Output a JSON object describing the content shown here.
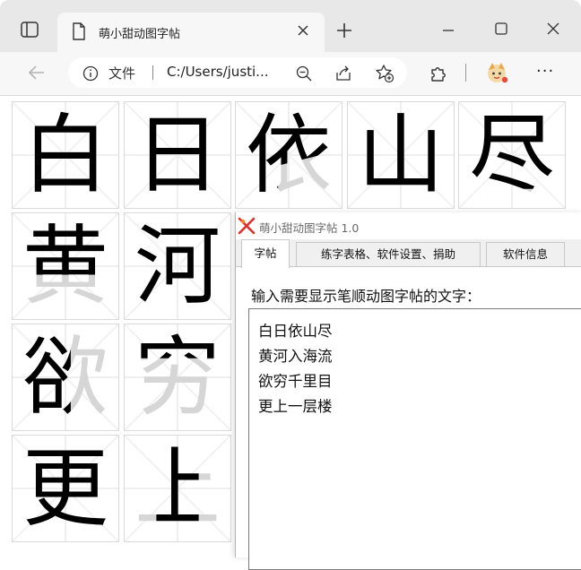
{
  "browser": {
    "tab_title": "萌小甜动图字帖",
    "address_file_label": "文件",
    "address_url": "C:/Users/justi...",
    "more_label": "···"
  },
  "grid": {
    "cells": [
      {
        "char": "白",
        "stage": "complete"
      },
      {
        "char": "日",
        "stage": "complete"
      },
      {
        "char": "依",
        "stage": "partial"
      },
      {
        "char": "山",
        "stage": "complete"
      },
      {
        "char": "尽",
        "stage": "partial"
      },
      {
        "char": "黄",
        "stage": "partial"
      },
      {
        "char": "河",
        "stage": "complete"
      },
      {
        "char": "欲",
        "stage": "partial"
      },
      {
        "char": "穷",
        "stage": "partial"
      },
      {
        "char": "更",
        "stage": "complete"
      },
      {
        "char": "上",
        "stage": "partial"
      }
    ]
  },
  "app": {
    "title": "萌小甜动图字帖 1.0",
    "tabs": [
      {
        "label": "字帖",
        "active": true
      },
      {
        "label": "练字表格、软件设置、捐助",
        "active": false
      },
      {
        "label": "软件信息",
        "active": false
      }
    ],
    "prompt": "输入需要显示笔顺动图字帖的文字：",
    "text_lines": [
      "白日依山尽",
      "黄河入海流",
      "欲穷千里目",
      "更上一层楼"
    ]
  }
}
